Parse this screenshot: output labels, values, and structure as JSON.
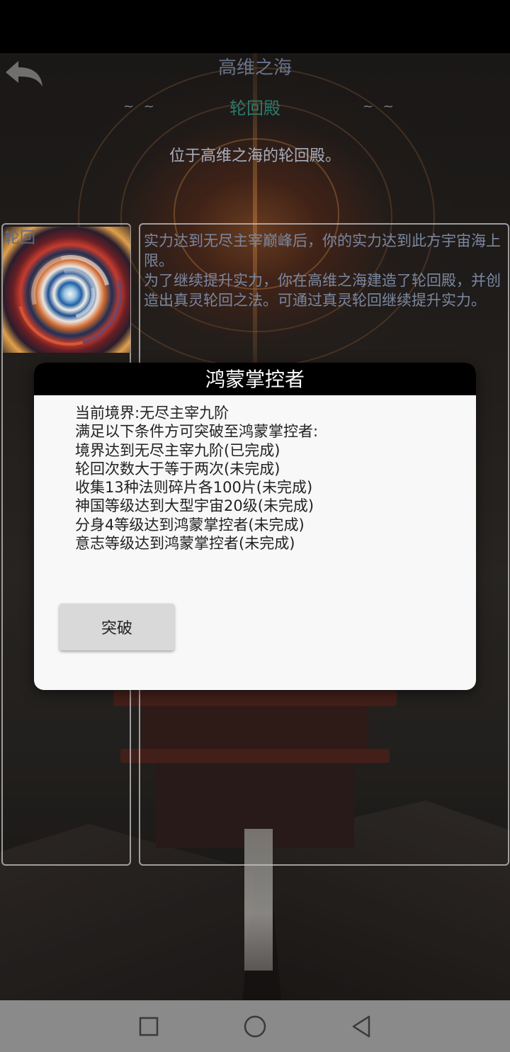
{
  "header": {
    "title": "高维之海",
    "subtitle": "轮回殿",
    "wave_left": "~ ~",
    "wave_right": "~ ~",
    "description": "位于高维之海的轮回殿。"
  },
  "left_panel": {
    "label": "轮回"
  },
  "right_panel": {
    "story": "实力达到无尽主宰巅峰后，你的实力达到此方宇宙海上限。\n为了继续提升实力，你在高维之海建造了轮回殿，并创造出真灵轮回之法。可通过真灵轮回继续提升实力。"
  },
  "modal": {
    "title": "鸿蒙掌控者",
    "lines": [
      "当前境界:无尽主宰九阶",
      "满足以下条件方可突破至鸿蒙掌控者:",
      "境界达到无尽主宰九阶(已完成)",
      "轮回次数大于等于两次(未完成)",
      "收集13种法则碎片各100片(未完成)",
      "神国等级达到大型宇宙20级(未完成)",
      "分身4等级达到鸿蒙掌控者(未完成)",
      "意志等级达到鸿蒙掌控者(未完成)"
    ],
    "button_label": "突破"
  },
  "icons": {
    "back": "back-arrow-icon",
    "nav_recent": "square-icon",
    "nav_home": "circle-icon",
    "nav_back": "triangle-back-icon"
  },
  "colors": {
    "modal_header": "#000000",
    "modal_body": "#f8f8f8",
    "nav_bar": "#8a8a8a"
  }
}
